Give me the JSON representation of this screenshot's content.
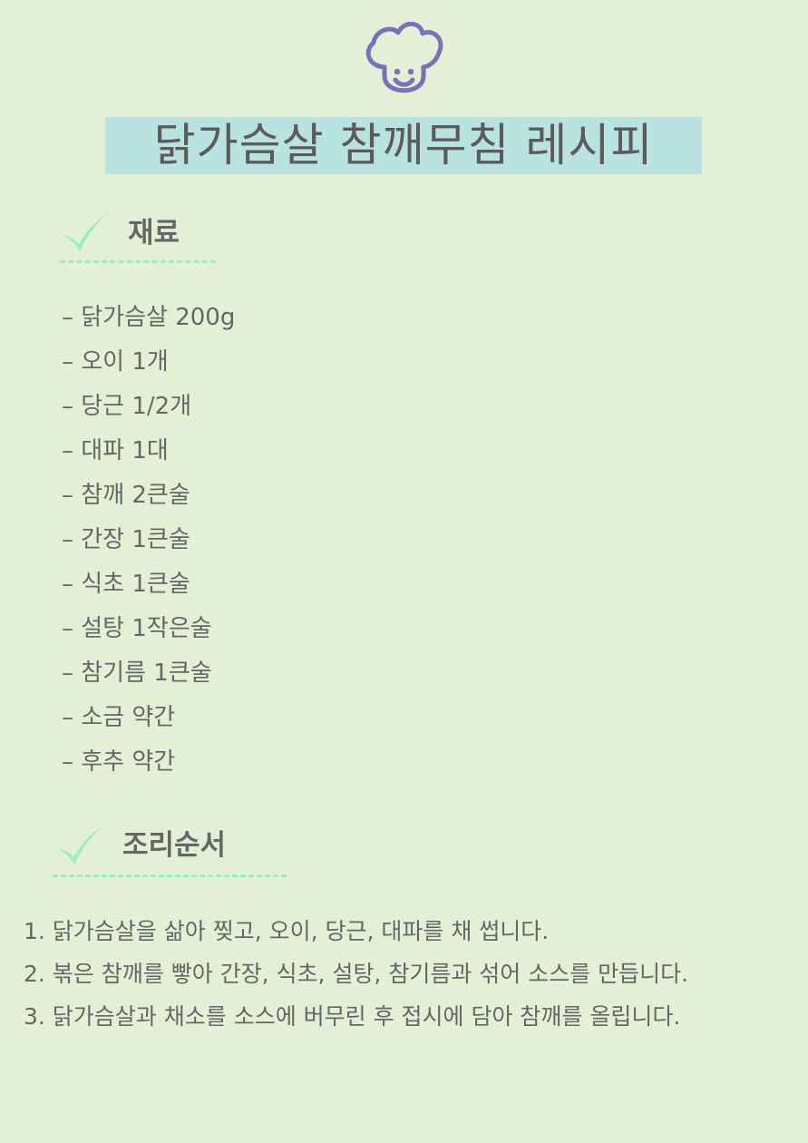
{
  "title": "닭가슴살 참깨무침 레시피",
  "icon": "chef-hat-face-icon",
  "colors": {
    "background": "#e4f0d6",
    "title_highlight": "#b8e3e1",
    "check": "#9df0b5",
    "icon": "#7b71b8"
  },
  "ingredients": {
    "heading": "재료",
    "items": [
      "– 닭가슴살 200g",
      "– 오이 1개",
      "– 당근 1/2개",
      "– 대파 1대",
      "– 참깨 2큰술",
      "– 간장 1큰술",
      "– 식초 1큰술",
      "– 설탕 1작은술",
      "– 참기름 1큰술",
      "– 소금 약간",
      "– 후추 약간"
    ]
  },
  "steps": {
    "heading": "조리순서",
    "items": [
      "1. 닭가슴살을 삶아 찢고, 오이, 당근, 대파를 채 썹니다.",
      "2. 볶은 참깨를 빻아 간장, 식초, 설탕, 참기름과 섞어 소스를 만듭니다.",
      "3. 닭가슴살과 채소를 소스에 버무린 후 접시에 담아 참깨를 올립니다."
    ]
  }
}
